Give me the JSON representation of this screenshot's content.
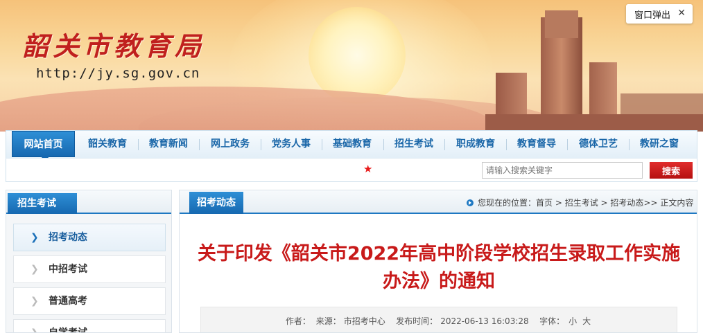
{
  "header": {
    "site_title": "韶关市教育局",
    "site_url": "http://jy.sg.gov.cn",
    "popup_label": "窗口弹出",
    "popup_close": "✕"
  },
  "nav": {
    "items": [
      {
        "label": "网站首页",
        "active": true
      },
      {
        "label": "韶关教育"
      },
      {
        "label": "教育新闻"
      },
      {
        "label": "网上政务"
      },
      {
        "label": "党务人事"
      },
      {
        "label": "基础教育"
      },
      {
        "label": "招生考试"
      },
      {
        "label": "职成教育"
      },
      {
        "label": "教育督导"
      },
      {
        "label": "德体卫艺"
      },
      {
        "label": "教研之窗"
      }
    ]
  },
  "search": {
    "star": "★",
    "placeholder": "请输入搜索关键字",
    "button": "搜索"
  },
  "sidebar": {
    "title": "招生考试",
    "items": [
      {
        "label": "招考动态",
        "active": true
      },
      {
        "label": "中招考试"
      },
      {
        "label": "普通高考"
      },
      {
        "label": "自学考试"
      }
    ]
  },
  "main": {
    "tab": "招考动态",
    "breadcrumb": {
      "prefix": "您现在的位置：",
      "home": "首页",
      "sep1": " > ",
      "level1": "招生考试",
      "sep2": " > ",
      "level2": "招考动态",
      "sep3": ">> ",
      "current": "正文内容"
    },
    "article": {
      "title": "关于印发《韶关市2022年高中阶段学校招生录取工作实施办法》的通知",
      "author_label": "作者：",
      "source_label": "来源：",
      "source": "市招考中心",
      "date_label": "发布时间：",
      "date": "2022-06-13 16:03:28",
      "font_label": "字体：",
      "font_small": "小",
      "font_large": "大"
    }
  },
  "colors": {
    "accent": "#1668b0",
    "title_red": "#c81a1a",
    "search_red": "#c41515"
  }
}
